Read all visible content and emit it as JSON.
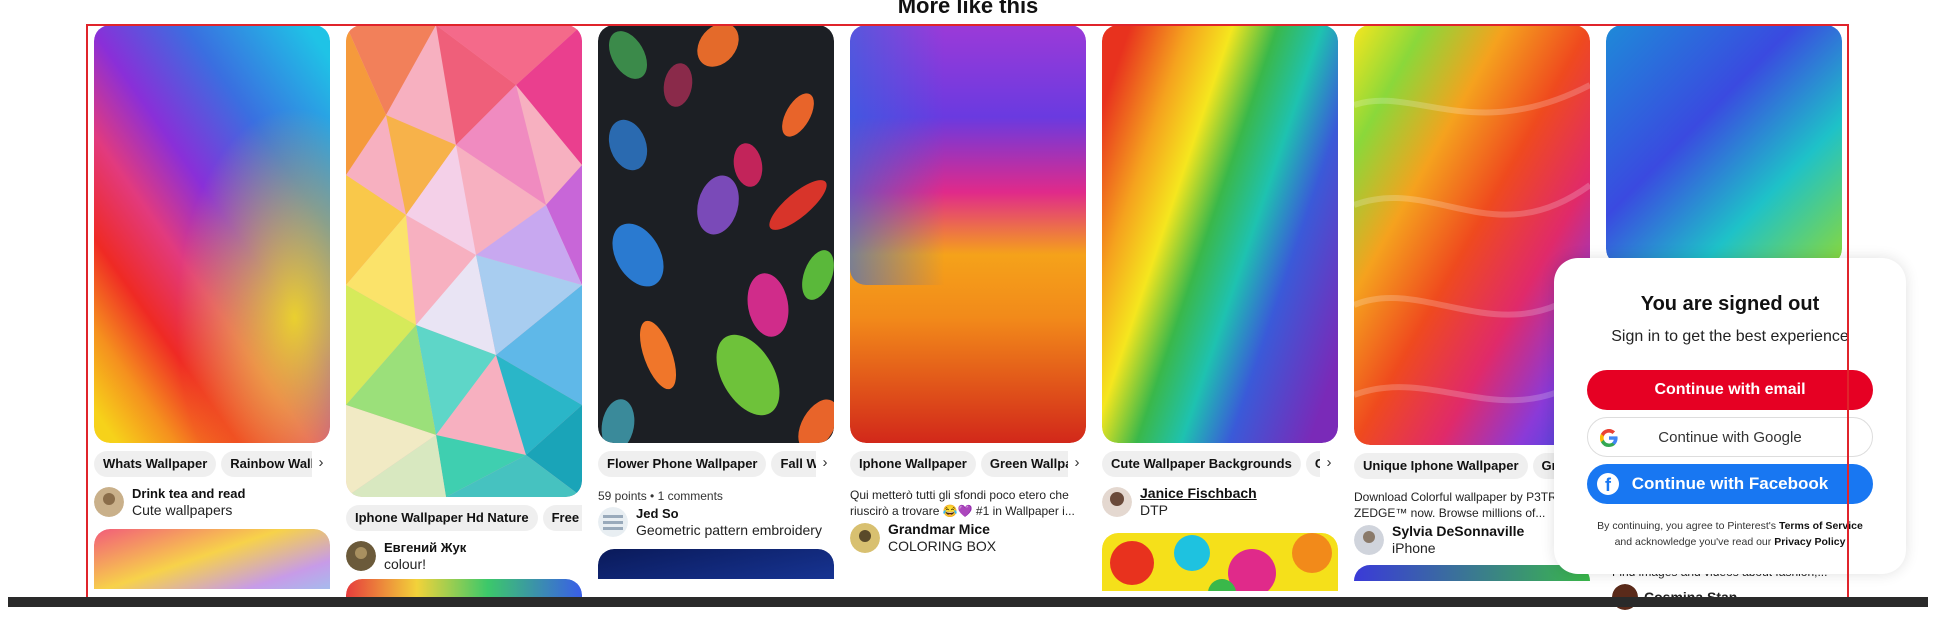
{
  "section_heading": "More like this",
  "pins": [
    {
      "chips": [
        "Whats Wallpaper",
        "Rainbow Wallpaper"
      ],
      "author": "Drink tea and read",
      "board": "Cute wallpapers"
    },
    {
      "chips": [
        "Iphone Wallpaper Hd Nature",
        "Free Wallpaper"
      ],
      "author": "Евгений Жук",
      "board": "colour!"
    },
    {
      "chips": [
        "Flower Phone Wallpaper",
        "Fall Wallpaper"
      ],
      "meta": "59 points • 1 comments",
      "author": "Jed So",
      "board": "Geometric pattern embroidery"
    },
    {
      "chips": [
        "Iphone Wallpaper",
        "Green Wallpaper"
      ],
      "description": "Qui metterò tutti gli sfondi poco etero che riuscirò a trovare 😂💜 #1 in Wallpaper i...",
      "author": "Grandmar Mice",
      "board": "COLORING BOX"
    },
    {
      "chips": [
        "Cute Wallpaper Backgrounds",
        "Cute Wallpapers"
      ],
      "author": "Janice Fischbach",
      "board": "DTP"
    },
    {
      "chips": [
        "Unique Iphone Wallpaper",
        "Graphic"
      ],
      "description": "Download Colorful wallpaper by P3TR on ZEDGE™ now. Browse millions of...",
      "author": "Sylvia DeSonnaville",
      "board": "iPhone"
    },
    {
      "description": "Find images and videos about fashion,...",
      "author": "Cosmina Stan"
    }
  ],
  "signin_card": {
    "title": "You are signed out",
    "subtitle": "Sign in to get the best experience",
    "email_button": "Continue with email",
    "google_button": "Continue with Google",
    "facebook_button": "Continue with Facebook",
    "terms_prefix": "By continuing, you agree to Pinterest's",
    "terms_link": "Terms of Service",
    "terms_middle": "and acknowledge you've read our",
    "privacy_link": "Privacy Policy"
  },
  "colors": {
    "pinterest_red": "#e60023",
    "facebook_blue": "#1877f2",
    "frame_red": "#e0242b"
  }
}
